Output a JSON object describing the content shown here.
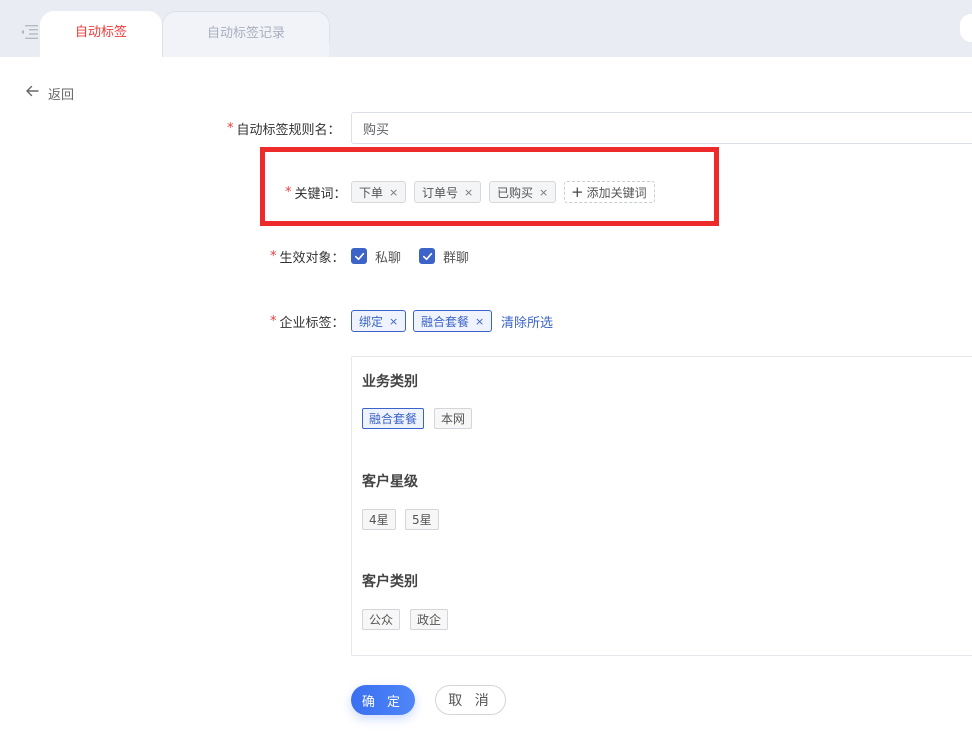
{
  "tabs": [
    {
      "label": "自动标签",
      "active": true
    },
    {
      "label": "自动标签记录",
      "active": false
    }
  ],
  "back_label": "返回",
  "form": {
    "rule_name": {
      "label": "自动标签规则名：",
      "value": "购买"
    },
    "keywords": {
      "label": "关键词：",
      "items": [
        "下单",
        "订单号",
        "已购买"
      ],
      "add_label": "添加关键词"
    },
    "target": {
      "label": "生效对象：",
      "options": [
        {
          "label": "私聊",
          "checked": true
        },
        {
          "label": "群聊",
          "checked": true
        }
      ]
    },
    "corp_tags": {
      "label": "企业标签：",
      "selected": [
        "绑定",
        "融合套餐"
      ],
      "clear_label": "清除所选"
    }
  },
  "tag_groups": [
    {
      "title": "业务类别",
      "tags": [
        {
          "label": "融合套餐",
          "selected": true
        },
        {
          "label": "本网",
          "selected": false
        }
      ]
    },
    {
      "title": "客户星级",
      "tags": [
        {
          "label": "4星",
          "selected": false
        },
        {
          "label": "5星",
          "selected": false
        }
      ]
    },
    {
      "title": "客户类别",
      "tags": [
        {
          "label": "公众",
          "selected": false
        },
        {
          "label": "政企",
          "selected": false
        }
      ]
    }
  ],
  "buttons": {
    "confirm": "确 定",
    "cancel": "取 消"
  },
  "required_mark": "*",
  "tag_close_glyph": "×",
  "add_glyph": "+",
  "colors": {
    "accent": "#3c63c8",
    "active_tab": "#ee3a3a",
    "required": "#ee3a3a",
    "highlight": "#ee2b2b"
  },
  "icons": [
    "menu-toggle-icon",
    "arrow-left-icon",
    "close-icon",
    "plus-icon",
    "check-icon"
  ]
}
